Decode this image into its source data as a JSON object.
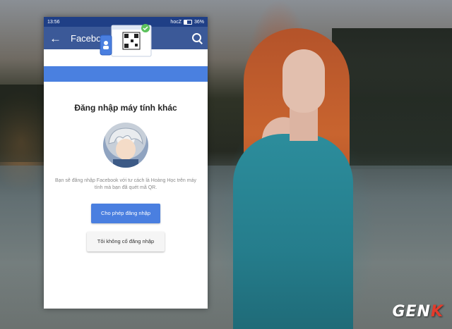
{
  "status_bar": {
    "time": "13:56",
    "network": "hocZ",
    "battery": "36%"
  },
  "app_bar": {
    "title": "Facebook"
  },
  "main": {
    "heading": "Đăng nhập máy tính khác",
    "description": "Bạn sẽ đăng nhập Facebook với tư cách là Hoàng Học trên máy tính mà bạn đã quét mã QR.",
    "allow_button": "Cho phép đăng nhập",
    "deny_button": "Tôi không cố đăng nhập"
  },
  "watermark": {
    "text": "GEN",
    "accent_letter": "K"
  },
  "colors": {
    "facebook_blue": "#3b5998",
    "hero_blue": "#4a80e0",
    "status_bar": "#1f3f86"
  },
  "icons": [
    "back-arrow-icon",
    "search-icon",
    "phone-qr-illustration",
    "checkmark-icon"
  ]
}
